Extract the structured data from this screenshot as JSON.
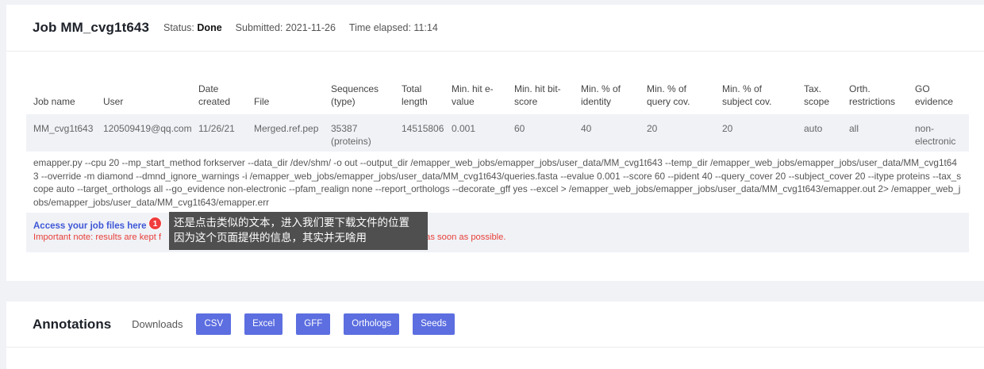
{
  "job": {
    "title": "Job MM_cvg1t643",
    "status_label": "Status:",
    "status_value": "Done",
    "submitted": "Submitted: 2021-11-26",
    "elapsed": "Time elapsed: 11:14"
  },
  "table": {
    "headers": [
      "Job name",
      "User",
      "Date created",
      "File",
      "Sequences (type)",
      "Total length",
      "Min. hit e-value",
      "Min. hit bit-score",
      "Min. % of identity",
      "Min. % of query cov.",
      "Min. % of subject cov.",
      "Tax. scope",
      "Orth. restrictions",
      "GO evidence"
    ],
    "row": [
      "MM_cvg1t643",
      "120509419@qq.com",
      "11/26/21",
      "Merged.ref.pep",
      "35387 (proteins)",
      "14515806",
      "0.001",
      "60",
      "40",
      "20",
      "20",
      "auto",
      "all",
      "non-electronic"
    ]
  },
  "command": "emapper.py --cpu 20 --mp_start_method forkserver --data_dir /dev/shm/ -o out --output_dir /emapper_web_jobs/emapper_jobs/user_data/MM_cvg1t643 --temp_dir /emapper_web_jobs/emapper_jobs/user_data/MM_cvg1t643 --override -m diamond --dmnd_ignore_warnings -i /emapper_web_jobs/emapper_jobs/user_data/MM_cvg1t643/queries.fasta --evalue 0.001 --score 60 --pident 40 --query_cover 20 --subject_cover 20 --itype proteins --tax_scope auto --target_orthologs all --go_evidence non-electronic --pfam_realign none --report_orthologs --decorate_gff yes --excel > /emapper_web_jobs/emapper_jobs/user_data/MM_cvg1t643/emapper.out 2> /emapper_web_jobs/emapper_jobs/user_data/MM_cvg1t643/emapper.err",
  "files": {
    "link": "Access your job files here",
    "note_visible": "Important note: results are kept f",
    "note_tail": "results as soon as possible."
  },
  "tooltip": {
    "badge": "1",
    "line1": "还是点击类似的文本，进入我们要下载文件的位置",
    "line2": "因为这个页面提供的信息，其实并无啥用"
  },
  "annotations": {
    "title": "Annotations",
    "downloads_label": "Downloads",
    "buttons": [
      "CSV",
      "Excel",
      "GFF",
      "Orthologs",
      "Seeds"
    ]
  },
  "colors": {
    "accent": "#5c6ee0",
    "link": "#3e57d6",
    "warning": "#e8403a",
    "tooltip_bg": "#4f4f4f",
    "badge": "#f03c3c"
  }
}
